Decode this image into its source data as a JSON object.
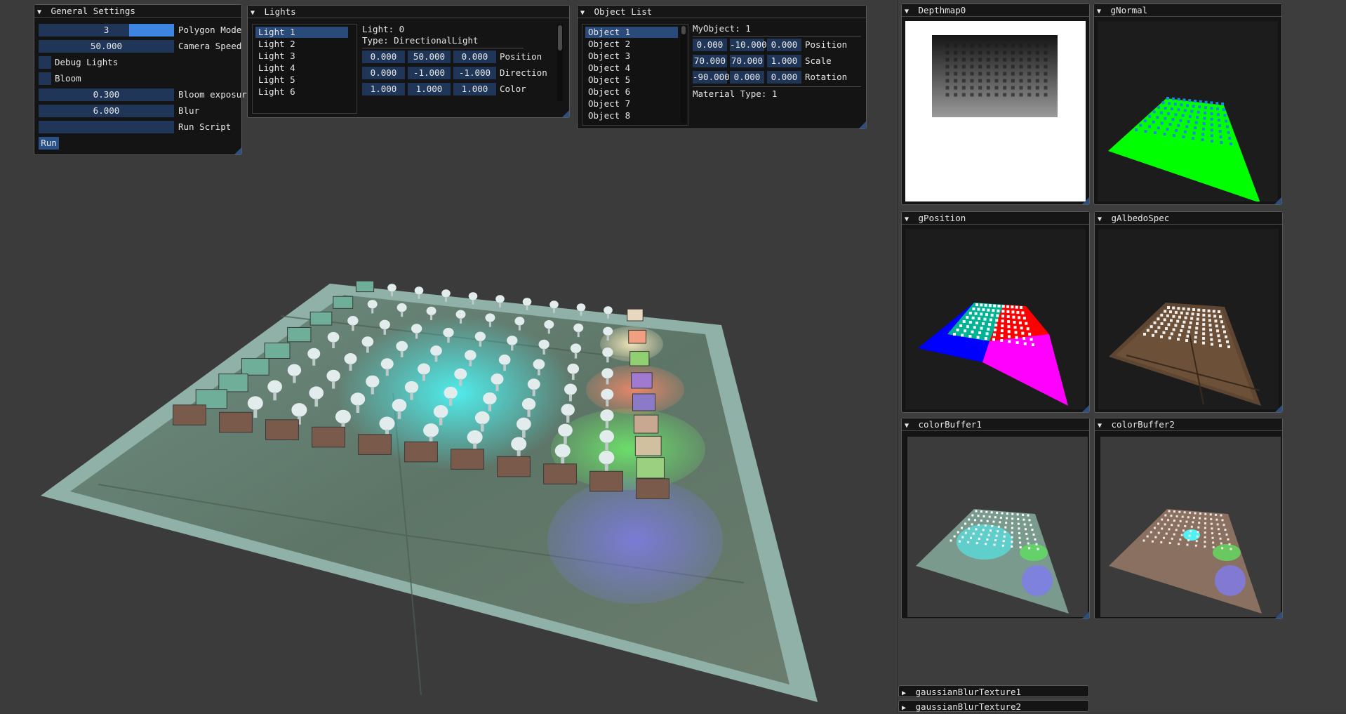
{
  "general_settings": {
    "title": "General Settings",
    "polygon_mode": {
      "value": "3",
      "label": "Polygon Mode",
      "fraction": 0.67
    },
    "camera_speed": {
      "value": "50.000",
      "label": "Camera Speed"
    },
    "debug_lights": {
      "label": "Debug Lights",
      "checked": false
    },
    "bloom": {
      "label": "Bloom",
      "checked": false
    },
    "bloom_exposure": {
      "value": "0.300",
      "label": "Bloom exposur"
    },
    "blur": {
      "value": "6.000",
      "label": "Blur"
    },
    "run_script": {
      "value": "",
      "label": "Run Script"
    },
    "run_button": "Run"
  },
  "lights": {
    "title": "Lights",
    "items": [
      "Light 1",
      "Light 2",
      "Light 3",
      "Light 4",
      "Light 5",
      "Light 6"
    ],
    "selected_index": 0,
    "detail": {
      "light_id": "Light: 0",
      "type": "Type: DirectionalLight",
      "position": {
        "values": [
          "0.000",
          "50.000",
          "0.000"
        ],
        "label": "Position"
      },
      "direction": {
        "values": [
          "0.000",
          "-1.000",
          "-1.000"
        ],
        "label": "Direction"
      },
      "color": {
        "values": [
          "1.000",
          "1.000",
          "1.000"
        ],
        "label": "Color"
      }
    }
  },
  "object_list": {
    "title": "Object List",
    "items": [
      "Object 1",
      "Object 2",
      "Object 3",
      "Object 4",
      "Object 5",
      "Object 6",
      "Object 7",
      "Object 8"
    ],
    "selected_index": 0,
    "detail": {
      "name": "MyObject: 1",
      "position": {
        "values": [
          "0.000",
          "-10.000",
          "0.000"
        ],
        "label": "Position"
      },
      "scale": {
        "values": [
          "70.000",
          "70.000",
          "1.000"
        ],
        "label": "Scale"
      },
      "rotation": {
        "values": [
          "-90.000",
          "0.000",
          "0.000"
        ],
        "label": "Rotation"
      },
      "material": "Material Type: 1"
    }
  },
  "buffers": {
    "depthmap": "Depthmap0",
    "gnormal": "gNormal",
    "gposition": "gPosition",
    "galbedospec": "gAlbedoSpec",
    "colorbuffer1": "colorBuffer1",
    "colorbuffer2": "colorBuffer2",
    "gaussian1": "gaussianBlurTexture1",
    "gaussian2": "gaussianBlurTexture2"
  },
  "colors": {
    "window_bg": "#141414",
    "frame_bg": "#1f3658",
    "accent": "#3d85e0",
    "selected": "#2a4a7a",
    "viewport_bg": "#3b3b3b"
  },
  "icons": {
    "expanded": "triangle-down-icon",
    "collapsed": "triangle-right-icon",
    "resize": "resize-grip-icon"
  }
}
